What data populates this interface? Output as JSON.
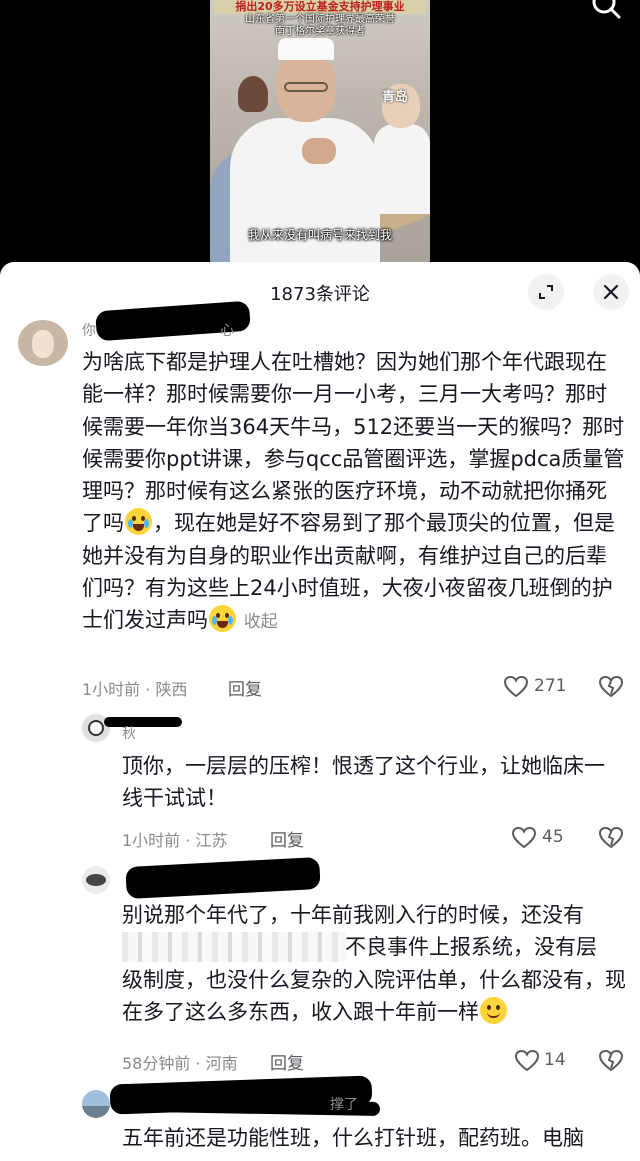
{
  "video": {
    "headline": "捐出20多万设立基金支持护理事业",
    "sub_line1": "山东省第一个国际护理界最高荣誉",
    "sub_line2": "南丁格尔奖章获得者",
    "watermark": "青岛",
    "subtitle": "我从来没有叫病号来找到我",
    "search_icon": "search-icon"
  },
  "sheet": {
    "title": "1873条评论",
    "expand_icon": "expand-icon",
    "close_icon": "close-icon"
  },
  "comments": [
    {
      "username": "你",
      "username_tail": "心",
      "text_before_emoji1": "为啥底下都是护理人在吐槽她？因为她们那个年代跟现在能一样？那时候需要你一月一小考，三月一大考吗？那时候需要一年你当364天牛马，512还要当一天的猴吗？那时候需要你ppt讲课，参与qcc品管圈评选，掌握pdca质量管理吗？那时候有这么紧张的医疗环境，动不动就把你捅死了吗",
      "text_between": "，现在她是好不容易到了那个最顶尖的位置，但是她并没有为自身的职业作出贡献啊，有维护过自己的后辈们吗？有为这些上24小时值班，大夜小夜留夜几班倒的护士们发过声吗",
      "collapse_label": "收起",
      "time_location": "1小时前 · 陕西",
      "reply_label": "回复",
      "like_count": "271"
    },
    {
      "username": "秋",
      "text": "顶你，一层层的压榨！恨透了这个行业，让她临床一线干试试！",
      "time_location": "1小时前 · 江苏",
      "reply_label": "回复",
      "like_count": "45"
    },
    {
      "username": "",
      "text_line1": "别说那个年代了，十年前我刚入行的时候，还没有",
      "text_line2_visible": "不良事件上报系统，没有层",
      "text_rest": "级制度，也没什么复杂的入院评估单，什么都没有，现在多了这么多东西，收入跟十年前一样",
      "time_location": "58分钟前 · 河南",
      "reply_label": "回复",
      "like_count": "14"
    },
    {
      "username_tail": "撑了",
      "text": "五年前还是功能性班，什么打针班，配药班。电脑"
    }
  ]
}
